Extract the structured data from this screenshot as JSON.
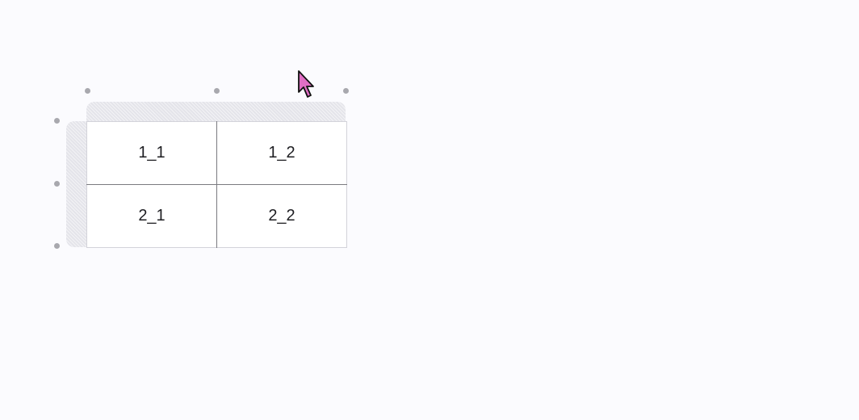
{
  "table": {
    "rows": [
      {
        "cells": [
          "1_1",
          "1_2"
        ]
      },
      {
        "cells": [
          "2_1",
          "2_2"
        ]
      }
    ]
  },
  "colors": {
    "background": "#fbfbfe",
    "handle_bar": "#e4e4ea",
    "handle_dot": "#a8a8ae",
    "cell_border": "#7a7a80",
    "outer_border": "#d3d3da",
    "cursor_fill": "#e06fc5"
  },
  "icons": {
    "mouse_cursor": "pointer-arrow-icon"
  }
}
